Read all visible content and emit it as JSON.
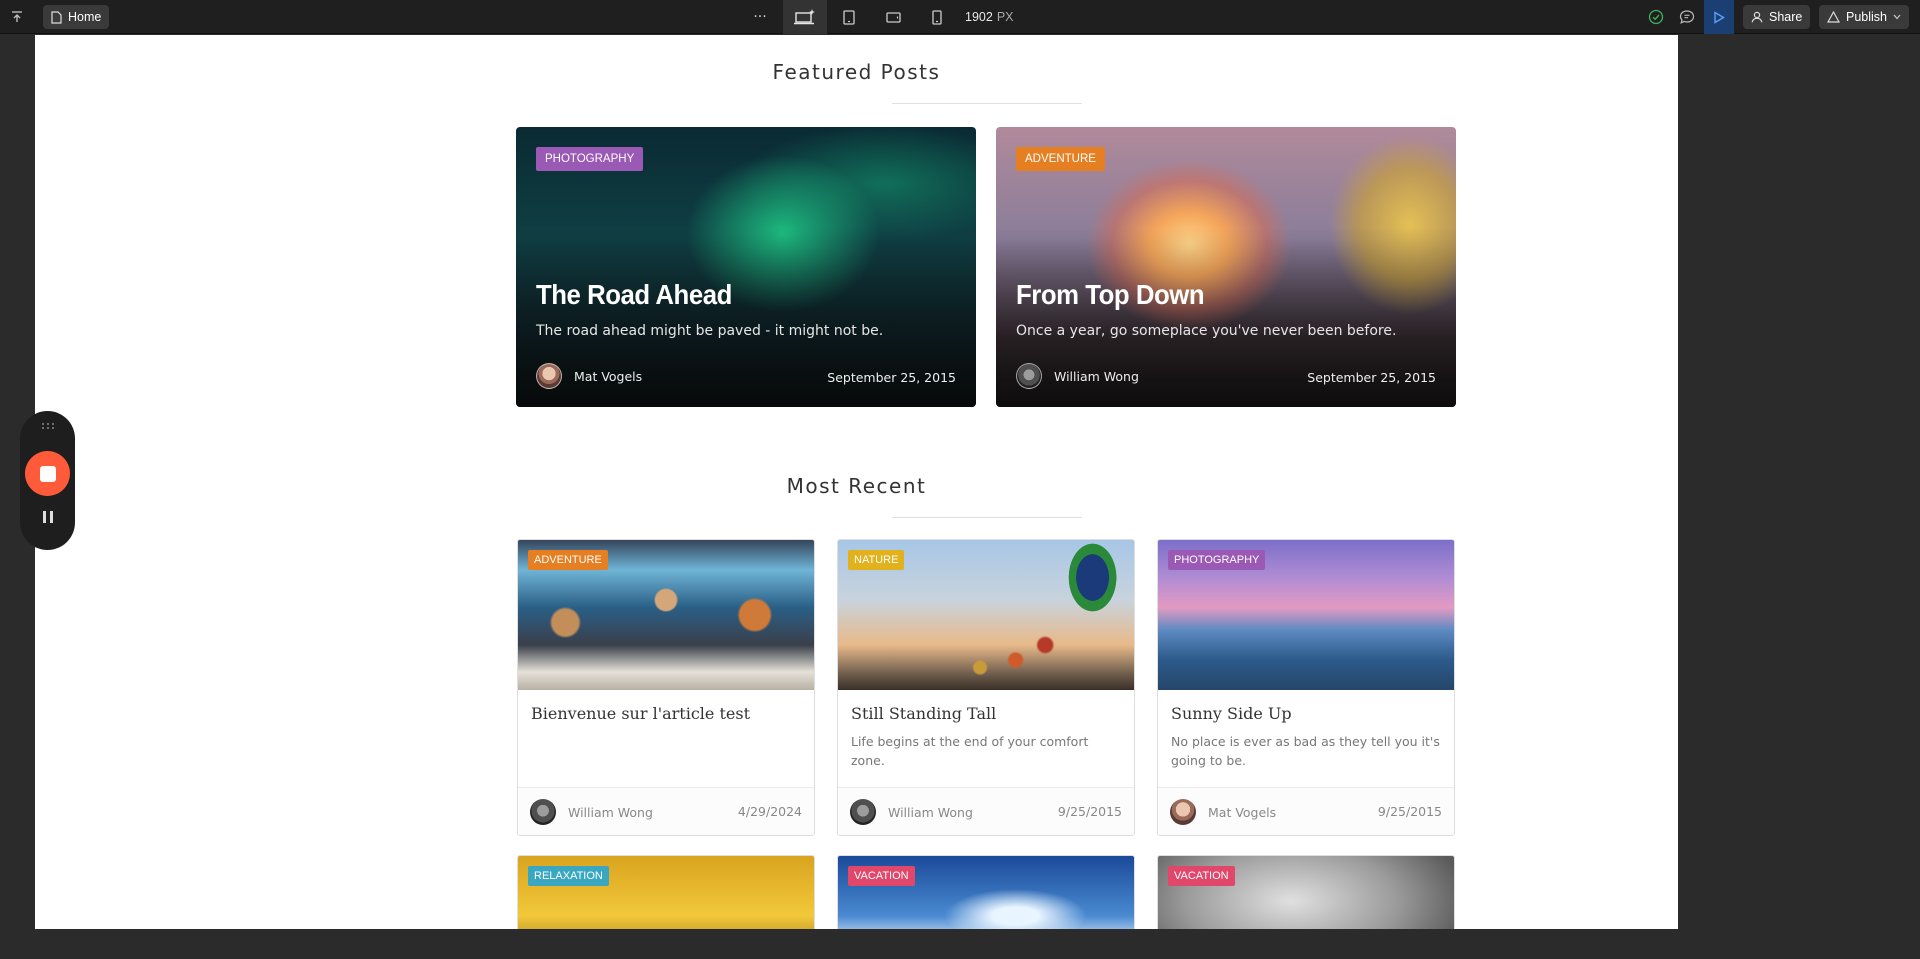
{
  "toolbar": {
    "page_name": "Home",
    "more_glyph": "···",
    "width_value": "1902",
    "width_unit": "PX",
    "share_label": "Share",
    "publish_label": "Publish",
    "accent_color": "#1c3f73"
  },
  "featured": {
    "title": "Featured Posts",
    "posts": [
      {
        "badge": "PHOTOGRAPHY",
        "badge_color": "#9b59b6",
        "title": "The Road Ahead",
        "subtitle": "The road ahead might be paved - it might not be.",
        "author": "Mat Vogels",
        "date": "September 25, 2015"
      },
      {
        "badge": "ADVENTURE",
        "badge_color": "#e67e22",
        "title": "From Top Down",
        "subtitle": "Once a year, go someplace you've never been before.",
        "author": "William Wong",
        "date": "September 25, 2015"
      }
    ]
  },
  "recent": {
    "title": "Most Recent",
    "posts": [
      {
        "badge": "ADVENTURE",
        "badge_color": "#e67e22",
        "title": "Bienvenue sur l'article test",
        "subtitle": "",
        "author": "William Wong",
        "date": "4/29/2024"
      },
      {
        "badge": "NATURE",
        "badge_color": "#e1b21d",
        "title": "Still Standing Tall",
        "subtitle": "Life begins at the end of your comfort zone.",
        "author": "William Wong",
        "date": "9/25/2015"
      },
      {
        "badge": "PHOTOGRAPHY",
        "badge_color": "#9b59b6",
        "title": "Sunny Side Up",
        "subtitle": "No place is ever as bad as they tell you it's going to be.",
        "author": "Mat Vogels",
        "date": "9/25/2015"
      },
      {
        "badge": "RELAXATION",
        "badge_color": "#3aa7c2"
      },
      {
        "badge": "VACATION",
        "badge_color": "#e0476b"
      },
      {
        "badge": "VACATION",
        "badge_color": "#e0476b"
      }
    ]
  },
  "recorder": {
    "stop_color": "#ff5a3a"
  }
}
